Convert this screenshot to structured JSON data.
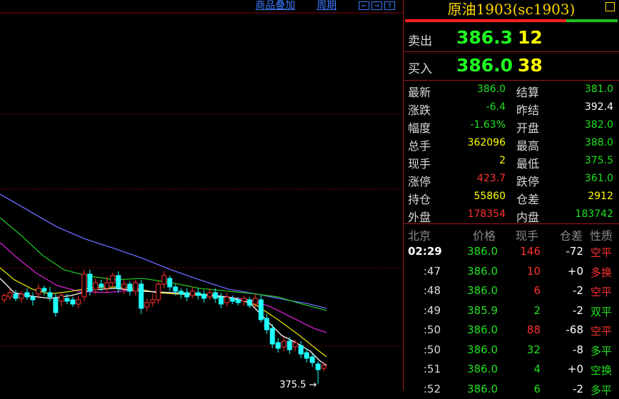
{
  "toolbar": {
    "overlay_label": "商品叠加",
    "period_label": "周期",
    "nav_buttons": [
      "⇐",
      "⇒",
      "⇑"
    ]
  },
  "chart": {
    "low_marker": "375.5",
    "colors": {
      "up": "#ff3030",
      "down": "#20ffff",
      "grid": "#8b0000"
    }
  },
  "panel": {
    "title": "原油1903(sc1903)",
    "ask_label": "卖出",
    "ask_price": "386.3",
    "ask_vol": "12",
    "bid_label": "买入",
    "bid_price": "386.0",
    "bid_vol": "38",
    "quote": [
      {
        "l1": "最新",
        "v1": "386.0",
        "c1": "green",
        "l2": "结算",
        "v2": "381.0",
        "c2": "green"
      },
      {
        "l1": "涨跌",
        "v1": "-6.4",
        "c1": "green",
        "l2": "昨结",
        "v2": "392.4",
        "c2": "white"
      },
      {
        "l1": "幅度",
        "v1": "-1.63%",
        "c1": "green",
        "l2": "开盘",
        "v2": "382.0",
        "c2": "green"
      },
      {
        "l1": "总手",
        "v1": "362096",
        "c1": "yellow",
        "l2": "最高",
        "v2": "388.0",
        "c2": "green"
      },
      {
        "l1": "现手",
        "v1": "2",
        "c1": "yellow",
        "l2": "最低",
        "v2": "375.5",
        "c2": "green"
      },
      {
        "l1": "涨停",
        "v1": "423.7",
        "c1": "red",
        "l2": "跌停",
        "v2": "361.0",
        "c2": "green"
      },
      {
        "l1": "持仓",
        "v1": "55860",
        "c1": "yellow",
        "l2": "仓差",
        "v2": "2912",
        "c2": "yellow"
      },
      {
        "l1": "外盘",
        "v1": "178354",
        "c1": "red",
        "l2": "内盘",
        "v2": "183742",
        "c2": "green"
      }
    ],
    "ticks_header": [
      "北京",
      "价格",
      "现手",
      "仓差",
      "性质"
    ],
    "ticks": [
      {
        "time": "02:29",
        "price": "386.0",
        "vol": "146",
        "vc": "red",
        "oi": "-72",
        "type": "空平",
        "tc": "red"
      },
      {
        "time": ":47",
        "price": "386.0",
        "vol": "10",
        "vc": "red",
        "oi": "+0",
        "type": "多换",
        "tc": "red"
      },
      {
        "time": ":48",
        "price": "386.0",
        "vol": "6",
        "vc": "red",
        "oi": "-2",
        "type": "空平",
        "tc": "red"
      },
      {
        "time": ":49",
        "price": "385.9",
        "vol": "2",
        "vc": "green",
        "oi": "-2",
        "type": "双平",
        "tc": "green"
      },
      {
        "time": ":50",
        "price": "386.0",
        "vol": "88",
        "vc": "red",
        "oi": "-68",
        "type": "空平",
        "tc": "red"
      },
      {
        "time": ":50",
        "price": "386.0",
        "vol": "32",
        "vc": "green",
        "oi": "-8",
        "type": "多平",
        "tc": "green"
      },
      {
        "time": ":51",
        "price": "386.0",
        "vol": "4",
        "vc": "green",
        "oi": "+0",
        "type": "空换",
        "tc": "green"
      },
      {
        "time": ":52",
        "price": "386.0",
        "vol": "6",
        "vc": "green",
        "oi": "-2",
        "type": "多平",
        "tc": "green"
      }
    ]
  }
}
